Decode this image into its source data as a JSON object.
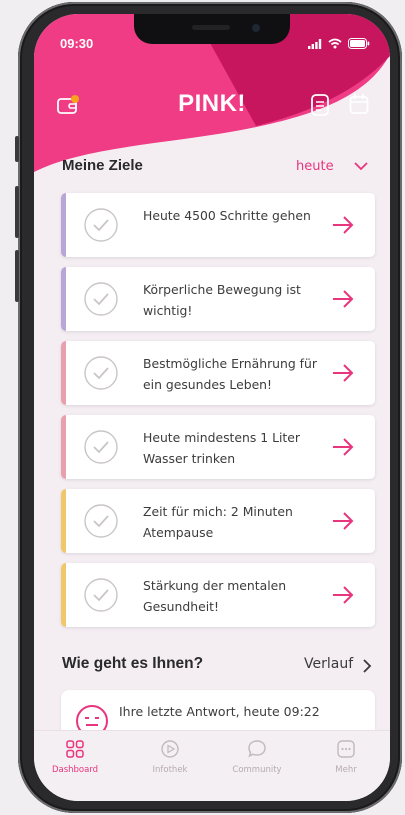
{
  "status_bar": {
    "time": "09:30"
  },
  "header": {
    "brand": "PINK!"
  },
  "goals": {
    "title": "Meine Ziele",
    "period": "heute",
    "items": [
      {
        "text": "Heute 4500 Schritte gehen",
        "accent": "#b9a6d6"
      },
      {
        "text": "Körperliche Bewegung ist wichtig!",
        "accent": "#b9a6d6"
      },
      {
        "text": "Bestmögliche Ernährung für ein gesundes Leben!",
        "accent": "#e8a0ad"
      },
      {
        "text": "Heute mindestens 1 Liter Wasser trinken",
        "accent": "#e8a0ad"
      },
      {
        "text": "Zeit für mich: 2 Minuten Atempause",
        "accent": "#f0c76a"
      },
      {
        "text": "Stärkung der mentalen Gesundheit!",
        "accent": "#f0c76a"
      }
    ]
  },
  "mood": {
    "title": "Wie geht es Ihnen?",
    "history_link": "Verlauf",
    "last_answer": "Ihre letzte Antwort, heute 09:22"
  },
  "tabbar": {
    "tabs": [
      {
        "label": "Dashboard",
        "icon": "grid-icon",
        "active": true
      },
      {
        "label": "Infothek",
        "icon": "play-icon",
        "active": false
      },
      {
        "label": "Community",
        "icon": "chat-bubble-icon",
        "active": false
      },
      {
        "label": "Mehr",
        "icon": "more-icon",
        "active": false
      }
    ]
  },
  "colors": {
    "brand_pink": "#f03c84",
    "brand_dark": "#c8165e",
    "accent_text": "#e8357d",
    "background": "#f4eef3"
  }
}
